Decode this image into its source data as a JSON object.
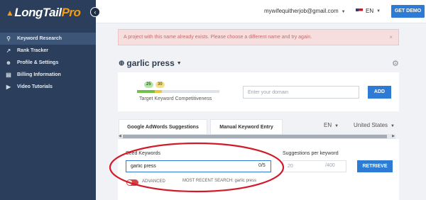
{
  "app": {
    "logo_main": "LongTail",
    "logo_accent": "Pro"
  },
  "sidebar": {
    "collapse_glyph": "‹",
    "items": [
      {
        "label": "Keyword Research",
        "icon": "search-icon",
        "glyph": "⚲",
        "active": true
      },
      {
        "label": "Rank Tracker",
        "icon": "trend-icon",
        "glyph": "↗",
        "active": false
      },
      {
        "label": "Profile & Settings",
        "icon": "user-icon",
        "glyph": "☻",
        "active": false
      },
      {
        "label": "Billing Information",
        "icon": "billing-icon",
        "glyph": "▤",
        "active": false
      },
      {
        "label": "Video Tutorials",
        "icon": "video-icon",
        "glyph": "▶",
        "active": false
      }
    ]
  },
  "topbar": {
    "email": "mywifequitherjob@gmail.com",
    "language": "EN",
    "demo_button": "GET DEMO"
  },
  "alert": {
    "message": "A project with this name already exists. Please choose a different name and try again.",
    "close": "×"
  },
  "project": {
    "name": "garlic press"
  },
  "competitiveness": {
    "badge_green": "25",
    "badge_yellow": "30",
    "label": "Target Keyword Competitiveness",
    "domain_placeholder": "Enter your domain",
    "add_button": "ADD",
    "colors": {
      "green": "#6cc24a",
      "yellow": "#e8c93d"
    }
  },
  "tabs": {
    "items": [
      "Google AdWords Suggestions",
      "Manual Keyword Entry"
    ],
    "language": "EN",
    "country": "United States"
  },
  "search": {
    "seed_label": "Seed Keywords",
    "seed_value": "garlic press",
    "seed_count": "0/5",
    "suggestions_label": "Suggestions per keyword",
    "suggestions_value": "20",
    "suggestions_max": "/400",
    "retrieve_button": "RETRIEVE",
    "advanced_label": "ADVANCED",
    "recent_search": "MOST RECENT SEARCH: garlic press"
  },
  "colors": {
    "sidebar": "#2b3f5c",
    "accent": "#2e7bd6",
    "alert_bg": "#f7dede",
    "annotation": "#d11a2a"
  }
}
